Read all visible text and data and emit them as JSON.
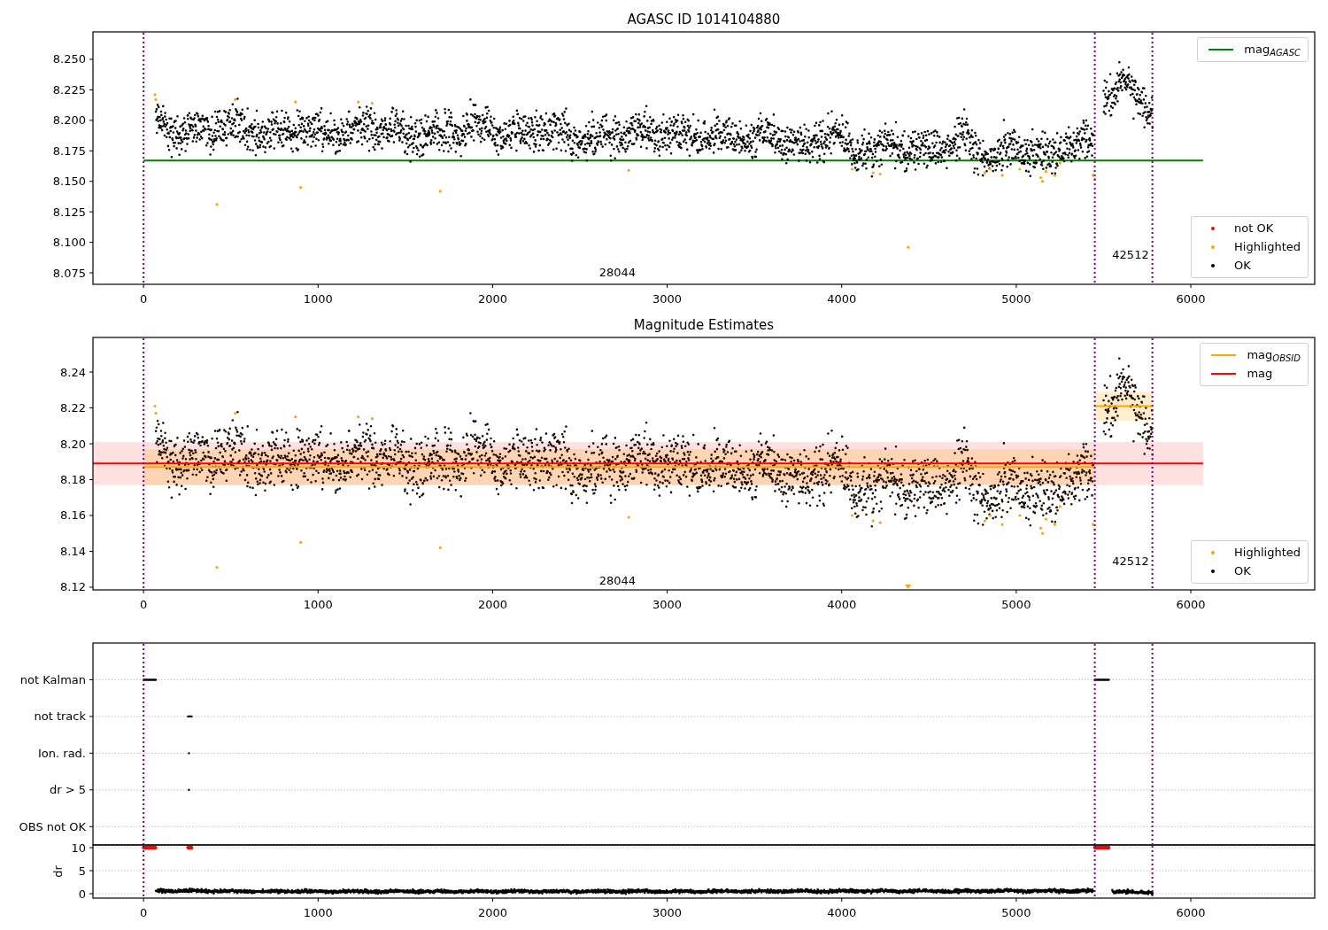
{
  "panels": [
    {
      "title": "AGASC ID 1014104880",
      "y_tick_labels": [
        "8.250",
        "8.225",
        "8.200",
        "8.175",
        "8.150",
        "8.125",
        "8.100",
        "8.075"
      ],
      "x_tick_labels": [
        "0",
        "1000",
        "2000",
        "3000",
        "4000",
        "5000",
        "6000"
      ],
      "annotations": [
        "28044",
        "42512"
      ],
      "legends": [
        {
          "entries": [
            {
              "label": "mag$_{AGASC}$",
              "color": "#008000",
              "kind": "line"
            }
          ]
        },
        {
          "entries": [
            {
              "label": "not OK",
              "color": "#ff0000",
              "kind": "marker"
            },
            {
              "label": "Highlighted",
              "color": "#ffa500",
              "kind": "marker"
            },
            {
              "label": "OK",
              "color": "#000000",
              "kind": "marker"
            }
          ]
        }
      ]
    },
    {
      "title": "Magnitude Estimates",
      "y_tick_labels": [
        "8.24",
        "8.22",
        "8.20",
        "8.18",
        "8.16",
        "8.14",
        "8.12"
      ],
      "x_tick_labels": [
        "0",
        "1000",
        "2000",
        "3000",
        "4000",
        "5000",
        "6000"
      ],
      "annotations": [
        "28044",
        "42512"
      ],
      "legends": [
        {
          "entries": [
            {
              "label": "mag$_{OBSID}$",
              "color": "#ffa500",
              "kind": "line"
            },
            {
              "label": "mag",
              "color": "#ff0000",
              "kind": "line"
            }
          ]
        },
        {
          "entries": [
            {
              "label": "Highlighted",
              "color": "#ffa500",
              "kind": "marker"
            },
            {
              "label": "OK",
              "color": "#000000",
              "kind": "marker"
            }
          ]
        }
      ]
    },
    {
      "y_tick_labels": [
        "not Kalman",
        "not track",
        "Ion. rad.",
        "dr > 5",
        "OBS not OK"
      ]
    },
    {
      "ylabel": "dr",
      "y_tick_labels": [
        "10",
        "5",
        "0"
      ],
      "x_tick_labels": [
        "0",
        "1000",
        "2000",
        "3000",
        "4000",
        "5000",
        "6000"
      ]
    }
  ]
}
